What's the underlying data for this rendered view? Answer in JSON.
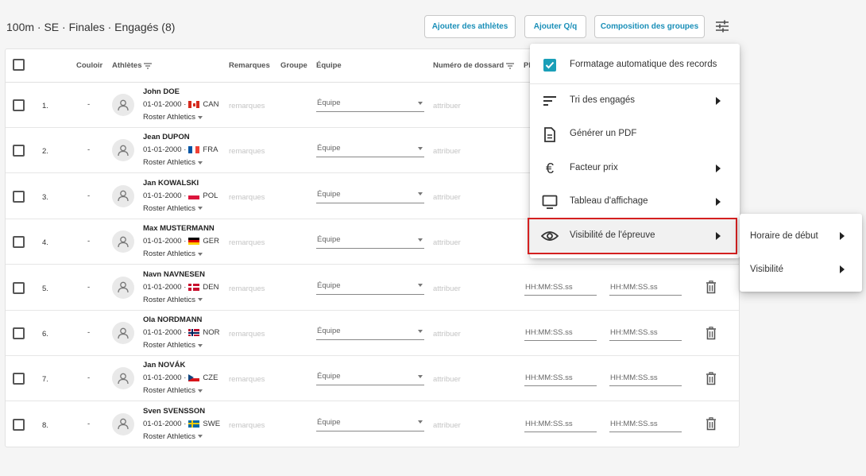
{
  "header": {
    "title": "100m · SE · Finales · Engagés (8)",
    "buttons": [
      "Ajouter des athlètes",
      "Ajouter Q/q",
      "Composition des groupes"
    ]
  },
  "table": {
    "columns": {
      "couloir": "Couloir",
      "athletes": "Athlètes",
      "remarques": "Remarques",
      "groupe": "Groupe",
      "equipe": "Équipe",
      "dossard": "Numéro de dossard",
      "pl": "Pl"
    },
    "remarks_placeholder": "remarques",
    "team_placeholder": "Équipe",
    "bib_placeholder": "attribuer",
    "time_placeholder": "HH:MM:SS.ss",
    "lane_value": "-",
    "rows": [
      {
        "num": "1.",
        "name": "John DOE",
        "dob": "01-01-2000 ·",
        "country": "CAN",
        "club": "Roster Athletics"
      },
      {
        "num": "2.",
        "name": "Jean DUPON",
        "dob": "01-01-2000 ·",
        "country": "FRA",
        "club": "Roster Athletics"
      },
      {
        "num": "3.",
        "name": "Jan KOWALSKI",
        "dob": "01-01-2000 ·",
        "country": "POL",
        "club": "Roster Athletics"
      },
      {
        "num": "4.",
        "name": "Max MUSTERMANN",
        "dob": "01-01-2000 ·",
        "country": "GER",
        "club": "Roster Athletics"
      },
      {
        "num": "5.",
        "name": "Navn NAVNESEN",
        "dob": "01-01-2000 ·",
        "country": "DEN",
        "club": "Roster Athletics"
      },
      {
        "num": "6.",
        "name": "Ola NORDMANN",
        "dob": "01-01-2000 ·",
        "country": "NOR",
        "club": "Roster Athletics"
      },
      {
        "num": "7.",
        "name": "Jan NOVÁK",
        "dob": "01-01-2000 ·",
        "country": "CZE",
        "club": "Roster Athletics"
      },
      {
        "num": "8.",
        "name": "Sven SVENSSON",
        "dob": "01-01-2000 ·",
        "country": "SWE",
        "club": "Roster Athletics"
      }
    ]
  },
  "menu": {
    "items": [
      {
        "label": "Formatage automatique des records",
        "icon": "checkbox-checked-icon",
        "arrow": false
      },
      {
        "label": "Tri des engagés",
        "icon": "sort-icon",
        "arrow": true
      },
      {
        "label": "Générer un PDF",
        "icon": "document-icon",
        "arrow": false
      },
      {
        "label": "Facteur prix",
        "icon": "euro-icon",
        "arrow": true
      },
      {
        "label": "Tableau d'affichage",
        "icon": "monitor-icon",
        "arrow": true
      },
      {
        "label": "Visibilité de l'épreuve",
        "icon": "eye-icon",
        "arrow": true
      }
    ]
  },
  "submenu": {
    "items": [
      {
        "label": "Horaire de début"
      },
      {
        "label": "Visibilité"
      }
    ]
  },
  "colors": {
    "accent": "#1a8fb8",
    "checkbox": "#1a9fb8",
    "highlight": "#d42020"
  }
}
